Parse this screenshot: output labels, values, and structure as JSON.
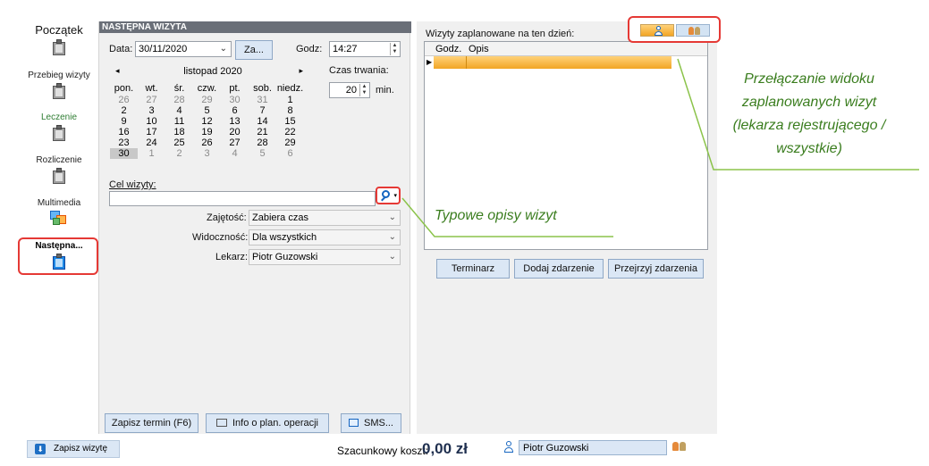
{
  "nav": {
    "items": [
      {
        "label": "Początek",
        "icon": "clipboard-icon"
      },
      {
        "label": "Przebieg wizyty",
        "icon": "clipboard-icon"
      },
      {
        "label": "Leczenie",
        "icon": "clipboard-pencil-icon"
      },
      {
        "label": "Rozliczenie",
        "icon": "clipboard-money-icon"
      },
      {
        "label": "Multimedia",
        "icon": "multimedia-icon"
      },
      {
        "label": "Następna...",
        "icon": "calendar-clipboard-icon"
      }
    ]
  },
  "form": {
    "title": "NASTĘPNA WIZYTA",
    "date_label": "Data:",
    "date_value": "30/11/2020",
    "za_button": "Za...",
    "time_label": "Godz:",
    "time_value": "14:27",
    "duration_label": "Czas trwania:",
    "duration_value": "20",
    "duration_unit": "min.",
    "purpose_label": "Cel wizyty:",
    "purpose_value": "",
    "occupancy_label": "Zajętość:",
    "occupancy_value": "Zabiera czas",
    "visibility_label": "Widoczność:",
    "visibility_value": "Dla wszystkich",
    "doctor_label": "Lekarz:",
    "doctor_value": "Piotr Guzowski",
    "buttons": {
      "save_term": "Zapisz termin (F6)",
      "info_plan": "Info o plan. operacji",
      "sms": "SMS..."
    }
  },
  "calendar": {
    "month": "listopad 2020",
    "prev": "◂",
    "next": "▸",
    "weekdays": [
      "pon.",
      "wt.",
      "śr.",
      "czw.",
      "pt.",
      "sob.",
      "niedz."
    ],
    "weeks": [
      [
        "26",
        "27",
        "28",
        "29",
        "30",
        "31",
        "1"
      ],
      [
        "2",
        "3",
        "4",
        "5",
        "6",
        "7",
        "8"
      ],
      [
        "9",
        "10",
        "11",
        "12",
        "13",
        "14",
        "15"
      ],
      [
        "16",
        "17",
        "18",
        "19",
        "20",
        "21",
        "22"
      ],
      [
        "23",
        "24",
        "25",
        "26",
        "27",
        "28",
        "29"
      ],
      [
        "30",
        "1",
        "2",
        "3",
        "4",
        "5",
        "6"
      ]
    ],
    "selected": "30"
  },
  "schedule": {
    "label": "Wizyty zaplanowane na ten dzień:",
    "columns": [
      "Godz.",
      "Opis"
    ],
    "buttons": {
      "terminarz": "Terminarz",
      "add_event": "Dodaj zdarzenie",
      "browse_events": "Przejrzyj zdarzenia"
    }
  },
  "annotations": {
    "view_toggle": [
      "Przełączanie widoku",
      "zaplanowanych wizyt",
      "(lekarza rejestrującego /",
      "wszystkie)"
    ],
    "typical": "Typowe opisy wizyt"
  },
  "footer": {
    "save_visit": "Zapisz wizytę",
    "cost_label": "Szacunkowy koszt:",
    "cost_value": "0,00 zł",
    "doctor": "Piotr Guzowski"
  },
  "colors": {
    "accent_orange": "#f2a524",
    "annotation_green": "#3a7d1e",
    "highlight_red": "#e53935",
    "panel_title": "#6a6f78"
  }
}
